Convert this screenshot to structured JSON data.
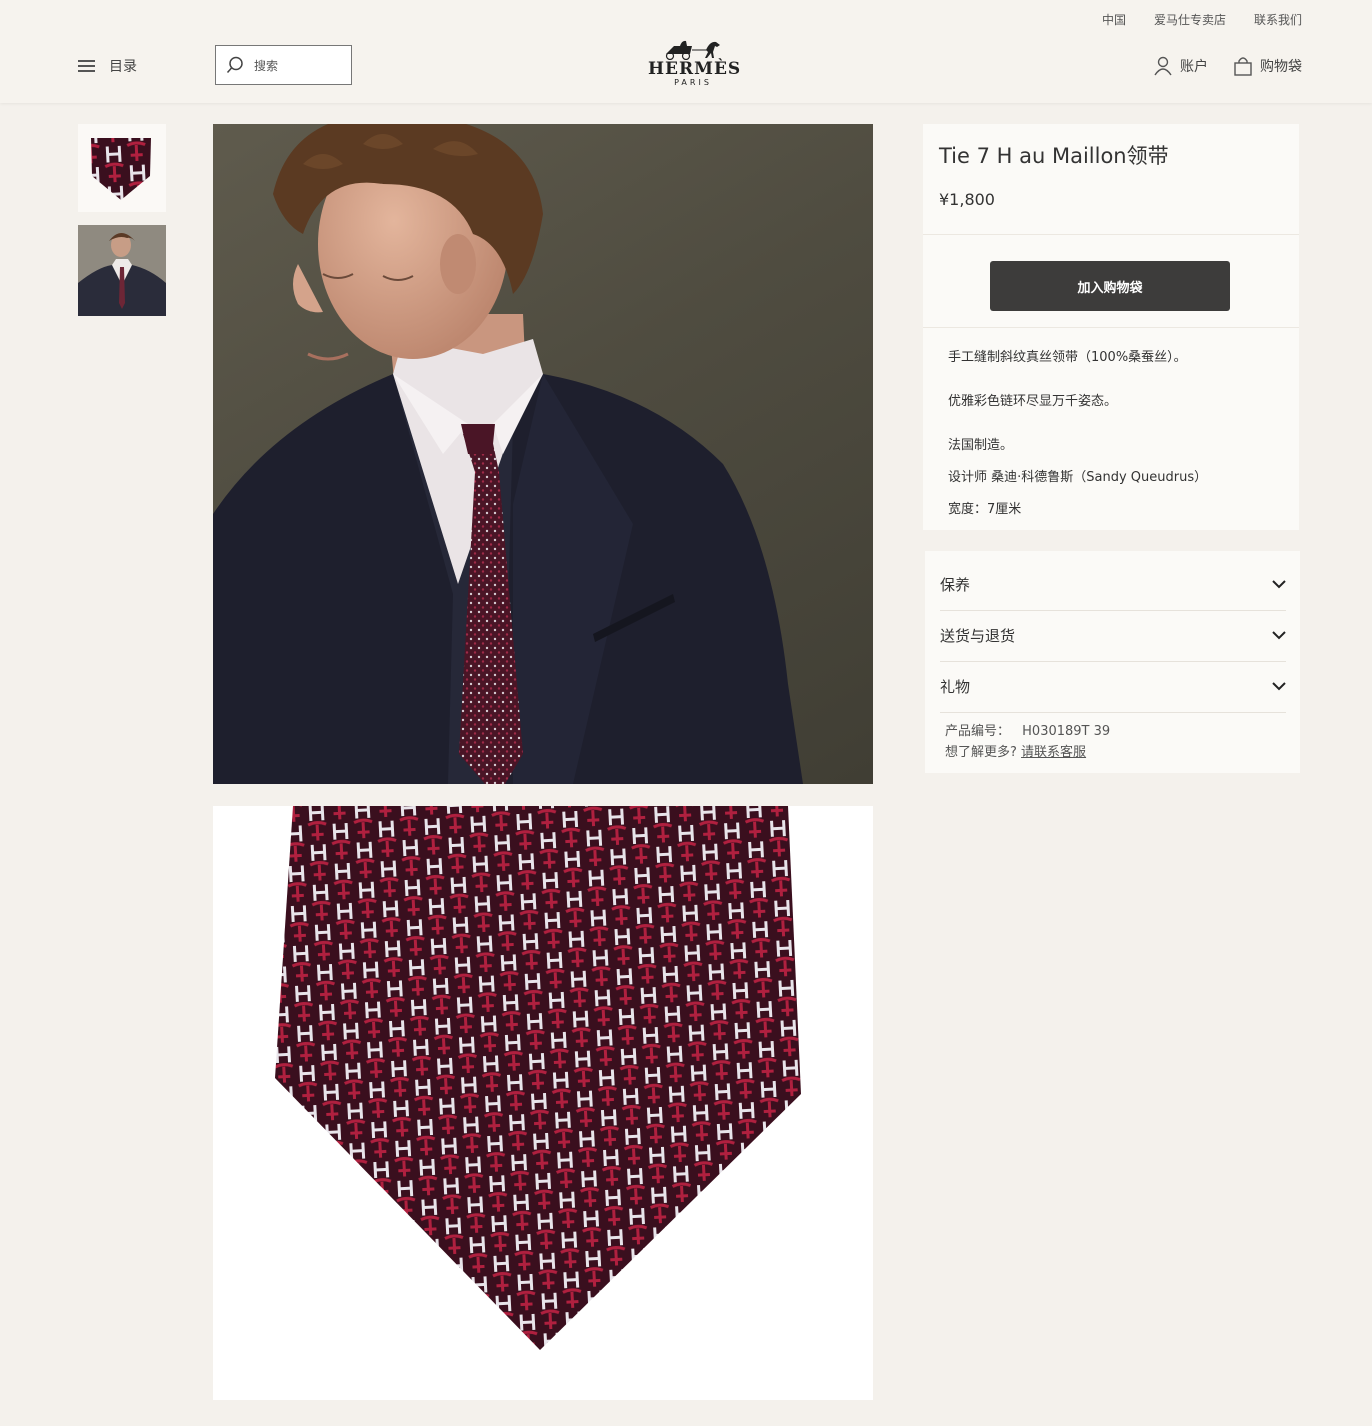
{
  "header": {
    "utility_links": [
      "中国",
      "爱马仕专卖店",
      "联系我们"
    ],
    "menu_label": "目录",
    "search_placeholder": "搜索",
    "logo_text": "HERMÈS",
    "logo_sub": "PARIS",
    "account_label": "账户",
    "bag_label": "购物袋"
  },
  "product": {
    "title": "Tie 7 H au Maillon领带",
    "price": "¥1,800",
    "add_to_bag": "加入购物袋",
    "description": [
      "手工缝制斜纹真丝领带（100%桑蚕丝）。",
      "优雅彩色链环尽显万千姿态。",
      "法国制造。",
      "设计师 桑迪·科德鲁斯（Sandy Queudrus）",
      "宽度：7厘米"
    ],
    "accordion": [
      "保养",
      "送货与退货",
      "礼物"
    ],
    "ref_label": "产品编号：",
    "ref_value": "H030189T 39",
    "more_label": "想了解更多?",
    "contact_link": "请联系客服"
  },
  "colors": {
    "background": "#f4f1ec",
    "panel": "#fbfaf7",
    "button": "#3d3c3b",
    "tie_base": "#3a0f1e",
    "tie_accent": "#b0203f"
  }
}
